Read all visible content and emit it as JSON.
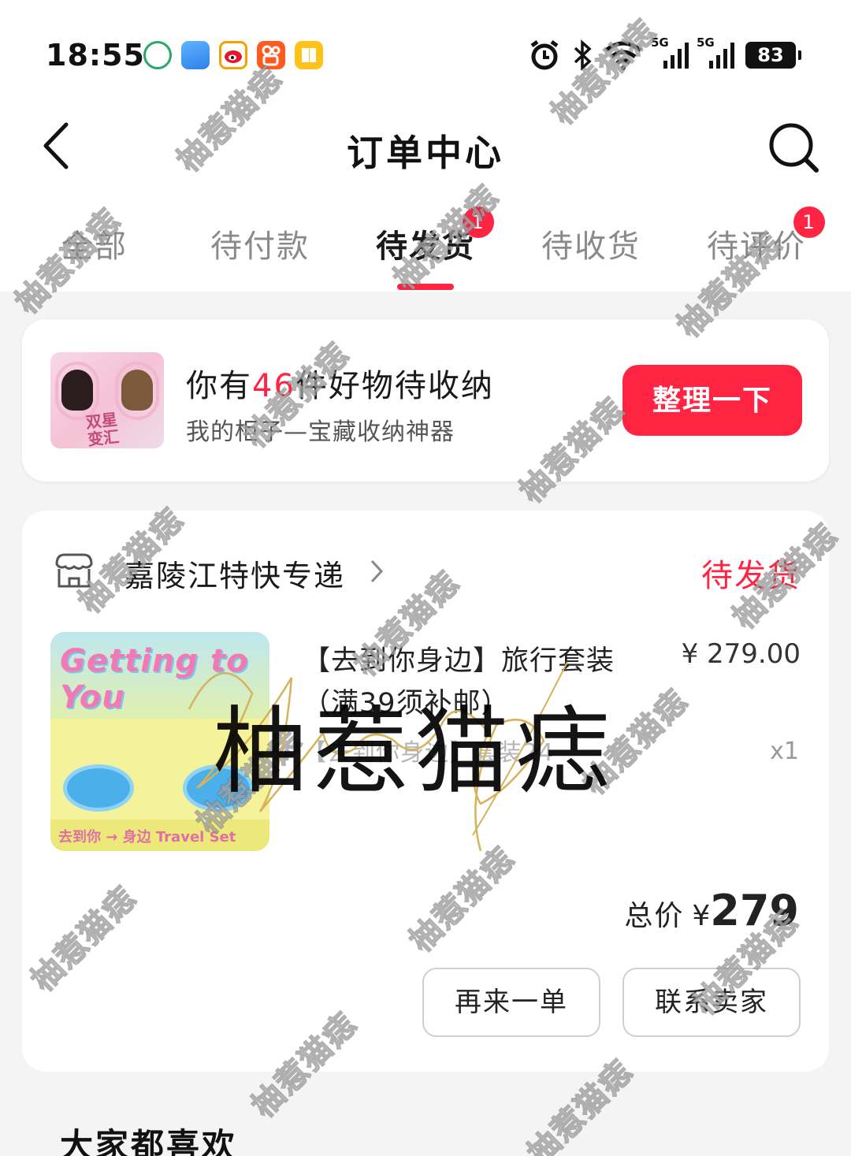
{
  "status_bar": {
    "time": "18:55",
    "network_type_1": "5G",
    "network_type_2": "5G",
    "battery": "83",
    "icons": [
      "bank-app-icon",
      "weather-app-icon",
      "weibo-app-icon",
      "kuaishou-app-icon",
      "reader-app-icon",
      "alarm-icon",
      "bluetooth-icon",
      "wifi-icon",
      "signal-icon",
      "battery-icon"
    ]
  },
  "nav": {
    "title": "订单中心",
    "back_icon": "chevron-left-icon",
    "search_icon": "search-icon"
  },
  "tabs": [
    {
      "label": "全部",
      "active": false,
      "badge": ""
    },
    {
      "label": "待付款",
      "active": false,
      "badge": ""
    },
    {
      "label": "待发货",
      "active": true,
      "badge": "1"
    },
    {
      "label": "待收货",
      "active": false,
      "badge": ""
    },
    {
      "label": "待评价",
      "active": false,
      "badge": "1"
    }
  ],
  "promo": {
    "text_prefix": "你有",
    "count": "46",
    "text_suffix": "件好物待收纳",
    "subtitle": "我的柜子—宝藏收纳神器",
    "button": "整理一下",
    "thumb_text": "双星\n变汇"
  },
  "order": {
    "shop_name": "嘉陵江特快专递",
    "status": "待发货",
    "product": {
      "title": "【去到你身边】旅行套装（满39须补邮）",
      "spec": "【去到你身边】套装24",
      "price": "¥ 279.00",
      "quantity": "x1",
      "image_header": "Getting to You",
      "image_footer": "去到你 → 身边   Travel Set"
    },
    "total_label": "总价",
    "total_currency": "¥",
    "total_amount": "279",
    "buttons": {
      "reorder": "再来一单",
      "contact": "联系卖家"
    }
  },
  "recommend": {
    "title": "大家都喜欢"
  },
  "watermark": {
    "text": "柚惹猫痣",
    "script": "Yourenmaozhi"
  },
  "colors": {
    "accent": "#ff2442",
    "background": "#f4f4f4",
    "card": "#ffffff"
  }
}
